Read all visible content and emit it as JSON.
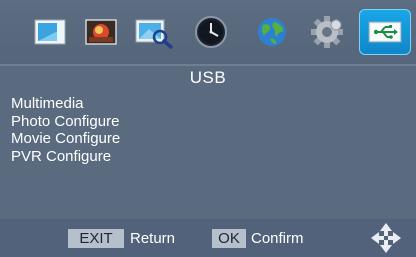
{
  "tabs": [
    {
      "icon": "picture-frame-icon",
      "selected": false
    },
    {
      "icon": "photo-icon",
      "selected": false
    },
    {
      "icon": "image-search-icon",
      "selected": false
    },
    {
      "icon": "clock-icon",
      "selected": false
    },
    {
      "icon": "globe-icon",
      "selected": false
    },
    {
      "icon": "gear-icon",
      "selected": false
    },
    {
      "icon": "usb-icon",
      "selected": true
    }
  ],
  "title": "USB",
  "menu": {
    "items": [
      "Multimedia",
      "Photo Configure",
      "Movie Configure",
      "PVR Configure"
    ]
  },
  "hints": {
    "exit_key": "EXIT",
    "exit_label": "Return",
    "ok_key": "OK",
    "ok_label": "Confirm",
    "nav_icon": "navigation-arrows-icon"
  },
  "colors": {
    "background": "#5a6b80",
    "selected_tab": "#19a7e8",
    "key_background": "#b6c0cc",
    "text": "#ffffff"
  }
}
